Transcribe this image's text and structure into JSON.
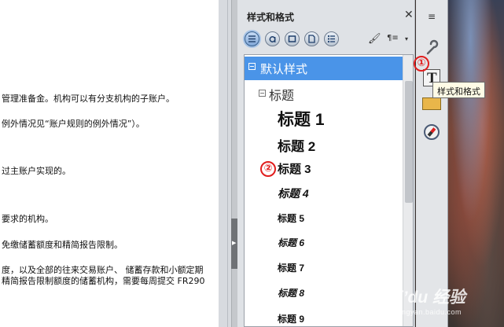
{
  "document": {
    "lines": [
      "管理准备金。机构可以有分支机构的子账户。",
      "例外情况见“账户规则的例外情况”）。",
      "过主账户实现的。",
      "要求的机构。",
      "免缴储蓄额度和精简报告限制。",
      "度，以及全部的往来交易账户、 储蓄存款和小额定期",
      "精简报告限制额度的储蓄机构，需要每周提交 FR290"
    ]
  },
  "panel": {
    "title": "样式和格式",
    "close_label": "✕",
    "toolbar": {
      "fill_glyph": "🖌",
      "new_glyph": "¶≡",
      "menu_glyph": "▾",
      "buttons": [
        "paragraph-styles",
        "character-styles",
        "frame-styles",
        "page-styles",
        "list-styles"
      ]
    },
    "styles": {
      "default": "默认样式",
      "heading_group": "标题",
      "headings": [
        "标题 1",
        "标题 2",
        "标题 3",
        "标题 4",
        "标题 5",
        "标题 6",
        "标题 7",
        "标题 8",
        "标题 9"
      ]
    }
  },
  "markers": {
    "first": "①",
    "second": "②"
  },
  "sidebar": {
    "menu_glyph": "≡",
    "styles_button_glyph": "T",
    "tooltip": "样式和格式"
  },
  "watermark": {
    "brand": "Bai’du 经验",
    "url": "jingyan.baidu.com"
  },
  "colors": {
    "selection": "#4a94e8",
    "marker": "#e11d1d",
    "panel_bg": "#dfe2e6"
  }
}
